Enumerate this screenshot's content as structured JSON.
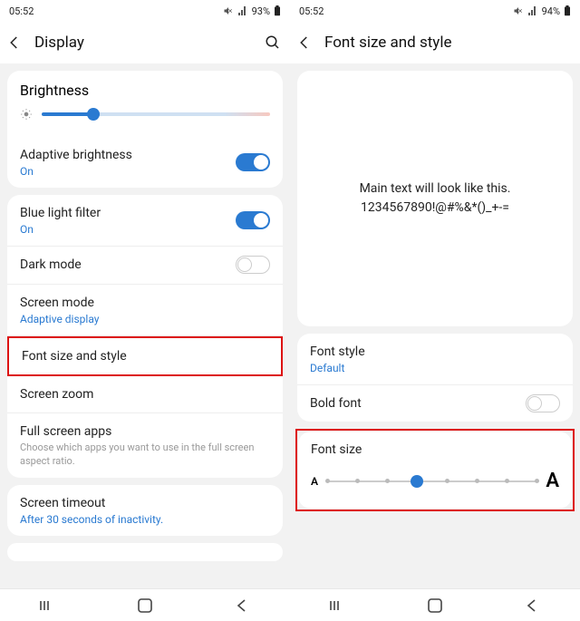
{
  "left": {
    "status": {
      "time": "05:52",
      "battery": "93%"
    },
    "title": "Display",
    "brightness": {
      "label": "Brightness",
      "value_pct": 22
    },
    "adaptive": {
      "label": "Adaptive brightness",
      "sub": "On",
      "on": true
    },
    "bluelight": {
      "label": "Blue light filter",
      "sub": "On",
      "on": true
    },
    "darkmode": {
      "label": "Dark mode",
      "on": false
    },
    "screenmode": {
      "label": "Screen mode",
      "sub": "Adaptive display"
    },
    "fontsize": {
      "label": "Font size and style"
    },
    "zoom": {
      "label": "Screen zoom"
    },
    "fullscreen": {
      "label": "Full screen apps",
      "desc": "Choose which apps you want to use in the full screen aspect ratio."
    },
    "timeout": {
      "label": "Screen timeout",
      "sub": "After 30 seconds of inactivity."
    }
  },
  "right": {
    "status": {
      "time": "05:52",
      "battery": "94%"
    },
    "title": "Font size and style",
    "preview": {
      "line1": "Main text will look like this.",
      "line2": "1234567890!@#%&*()_+-="
    },
    "fontstyle": {
      "label": "Font style",
      "sub": "Default"
    },
    "bold": {
      "label": "Bold font",
      "on": false
    },
    "fontsize": {
      "label": "Font size",
      "steps": 8,
      "current": 3
    }
  },
  "colors": {
    "accent": "#2a7ad1",
    "highlight": "#d11"
  }
}
